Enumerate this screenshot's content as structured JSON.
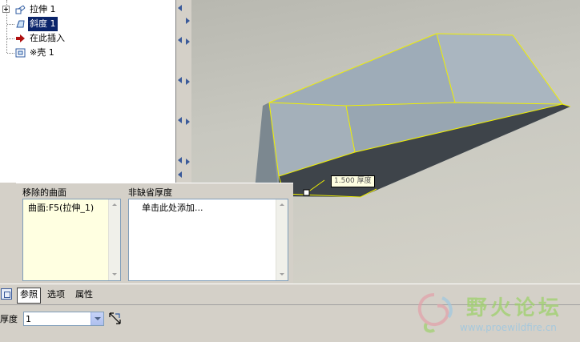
{
  "model_tree": {
    "items": [
      {
        "label": "拉伸 1",
        "icon": "extrude-icon",
        "expandable": true
      },
      {
        "label": "斜度 1",
        "icon": "draft-icon",
        "selected": true
      },
      {
        "label": "在此插入",
        "icon": "insert-here-arrow-icon"
      },
      {
        "label": "※壳 1",
        "icon": "shell-icon"
      }
    ]
  },
  "graphics": {
    "dimension_label": "1.500 厚度",
    "colors": {
      "part_face": "#9aa8b4",
      "edge_highlight": "#f0f000",
      "dark_face": "#3c4248"
    }
  },
  "panel": {
    "removed_surfaces": {
      "header": "移除的曲面",
      "items": [
        "曲面:F5(拉伸_1)"
      ]
    },
    "non_default_thickness": {
      "header": "非缺省厚度",
      "items": [
        "单击此处添加..."
      ]
    }
  },
  "dashboard": {
    "tabs": [
      "参照",
      "选项",
      "属性"
    ],
    "active_tab": "参照",
    "thickness_label": "厚度",
    "thickness_value": "1"
  },
  "watermark": {
    "title": "野火论坛",
    "url": "www.proewildfire.cn"
  }
}
